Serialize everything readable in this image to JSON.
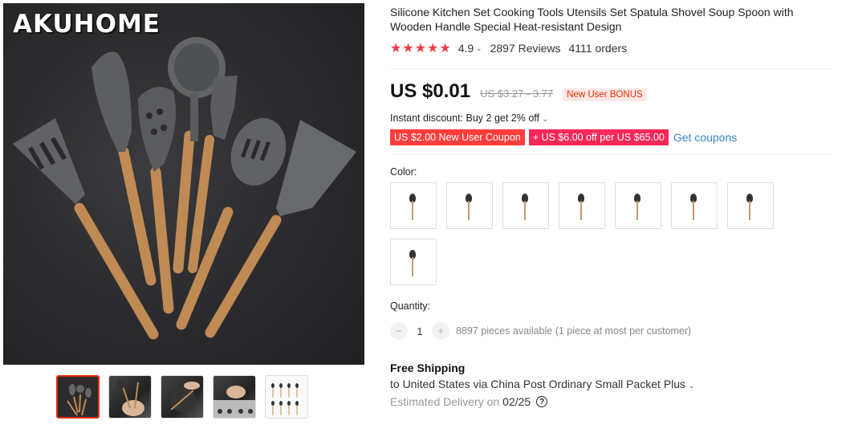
{
  "gallery": {
    "brand": "AKUHOME",
    "thumbnails": [
      "thumb-1",
      "thumb-2",
      "thumb-3",
      "thumb-4",
      "thumb-5"
    ],
    "active_thumbnail": 1
  },
  "product": {
    "title": "Silicone Kitchen Set Cooking Tools Utensils Set Spatula Shovel Soup Spoon with Wooden Handle Special Heat-resistant Design",
    "rating": "4.9",
    "stars": "★★★★★",
    "reviews": "2897 Reviews",
    "orders": "4111 orders"
  },
  "price": {
    "current": "US $0.01",
    "original": "US $3.27 - 3.77",
    "badge": "New User BONUS",
    "instant_discount": "Instant discount: Buy 2 get 2% off",
    "coupons": [
      "US $2.00 New User Coupon",
      "+ US $6.00 off per US $65.00"
    ],
    "get_coupons": "Get coupons"
  },
  "options": {
    "color_label": "Color:",
    "swatches": 8
  },
  "quantity": {
    "label": "Quantity:",
    "value": "1",
    "minus": "−",
    "plus": "+",
    "available": "8897 pieces available (1 piece at most per customer)"
  },
  "shipping": {
    "title": "Free Shipping",
    "detail": "to United States via China Post Ordinary Small Packet Plus",
    "delivery_label": "Estimated Delivery on",
    "delivery_date": "02/25",
    "help_icon": "?"
  },
  "colors": {
    "star": "#f23a4a",
    "accent": "#e62e04",
    "coupon_red": "#ff3d3d",
    "coupon_pink": "#f72858",
    "link": "#3b83c4"
  }
}
